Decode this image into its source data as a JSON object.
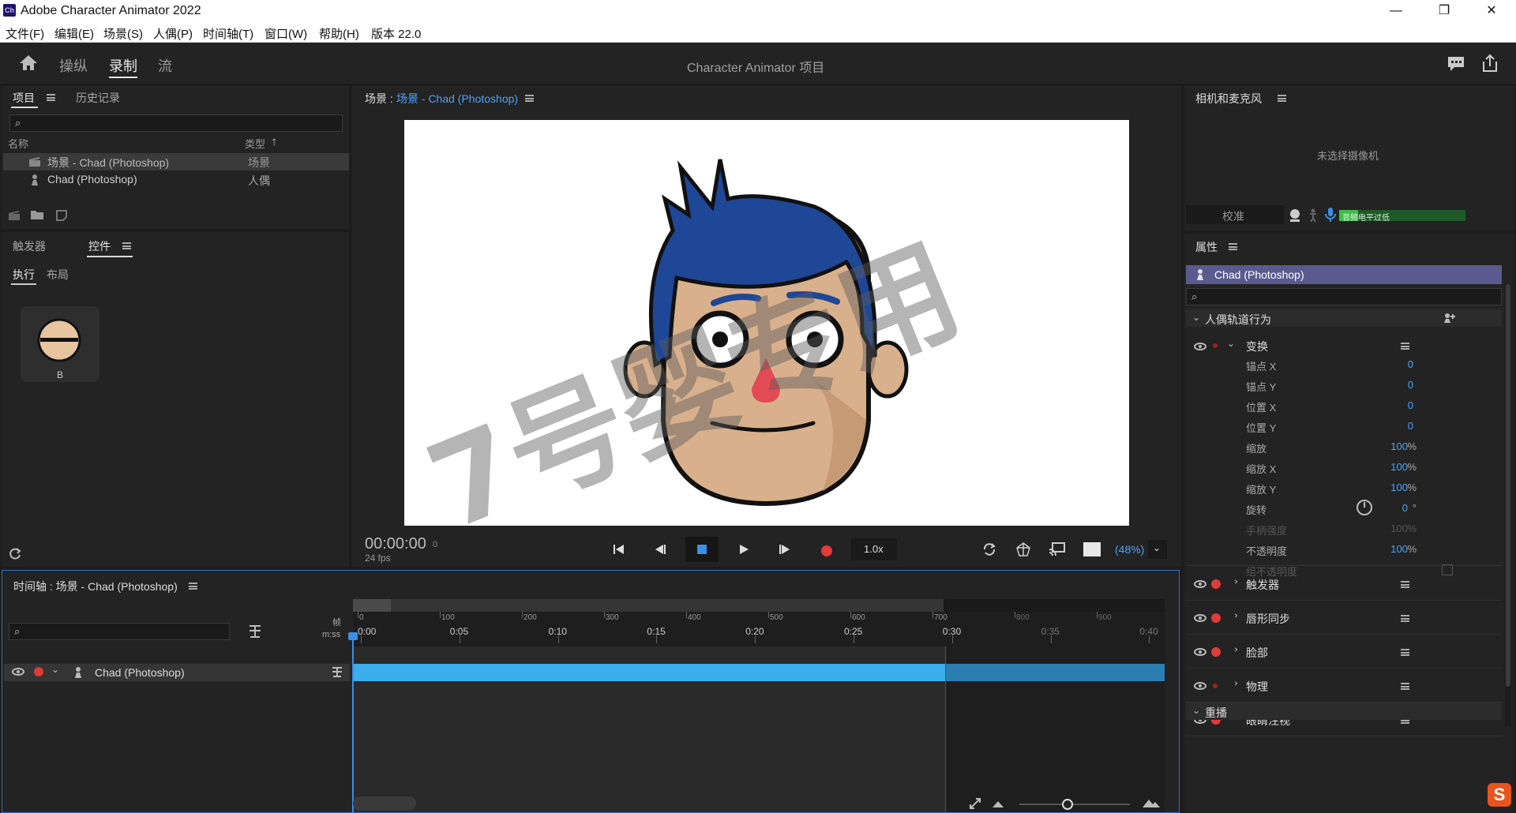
{
  "window": {
    "title": "Adobe Character Animator 2022",
    "app_icon_text": "Ch",
    "minimize": "—",
    "restore": "❐",
    "close": "✕"
  },
  "menu": [
    "文件(F)",
    "编辑(E)",
    "场景(S)",
    "人偶(P)",
    "时间轴(T)",
    "窗口(W)",
    "帮助(H)",
    "版本 22.0"
  ],
  "workspace": {
    "tabs": [
      "操纵",
      "录制",
      "流"
    ],
    "active_tab": "录制",
    "project_title": "Character Animator 项目"
  },
  "project_panel": {
    "tabs": [
      "项目",
      "历史记录"
    ],
    "col_name": "名称",
    "col_type": "类型",
    "sort_arrow": "🡑",
    "rows": [
      {
        "name": "场景 - Chad (Photoshop)",
        "type": "场景"
      },
      {
        "name": "Chad (Photoshop)",
        "type": "人偶"
      }
    ]
  },
  "triggers_panel": {
    "tabs": [
      "触发器",
      "控件"
    ],
    "subtabs": [
      "执行",
      "布局"
    ],
    "control_label": "B"
  },
  "scene_panel": {
    "title_prefix": "场景 : ",
    "title_link": "场景 - Chad (Photoshop)",
    "timecode": "00:00:00",
    "frame": "0",
    "fps": "24 fps",
    "speed": "1.0x",
    "zoom": "(48%)",
    "watermark": "7号婴专用"
  },
  "camera_panel": {
    "title": "相机和麦克风",
    "no_camera": "未选择摄像机",
    "calibrate": "校准",
    "audio_meter": "音频电平过低"
  },
  "properties_panel": {
    "title": "属性",
    "puppet_name": "Chad (Photoshop)",
    "section": "人偶轨道行为",
    "transform": "变换",
    "transform_params": [
      {
        "label": "锚点 X",
        "value": "0",
        "unit": "",
        "dim": false
      },
      {
        "label": "锚点 Y",
        "value": "0",
        "unit": "",
        "dim": false
      },
      {
        "label": "位置 X",
        "value": "0",
        "unit": "",
        "dim": false
      },
      {
        "label": "位置 Y",
        "value": "0",
        "unit": "",
        "dim": false
      },
      {
        "label": "缩放",
        "value": "100",
        "unit": "%",
        "dim": false
      },
      {
        "label": "缩放 X",
        "value": "100",
        "unit": "%",
        "dim": false
      },
      {
        "label": "缩放 Y",
        "value": "100",
        "unit": "%",
        "dim": false
      },
      {
        "label": "旋转",
        "value": "0",
        "unit": "°",
        "dim": false
      },
      {
        "label": "手柄强度",
        "value": "100",
        "unit": "%",
        "dim": true
      },
      {
        "label": "不透明度",
        "value": "100",
        "unit": "%",
        "dim": false
      },
      {
        "label": "组不透明度",
        "value": "",
        "unit": "",
        "dim": true
      }
    ],
    "behaviors": [
      "触发器",
      "唇形同步",
      "脸部",
      "物理",
      "眼睛注视"
    ],
    "replay": "重播"
  },
  "timeline_panel": {
    "title": "时间轴 : 场景 - Chad (Photoshop)",
    "frame_label": "帧",
    "mss_label": "m:ss",
    "frame_ticks": [
      "0",
      "100",
      "200",
      "300",
      "400",
      "500",
      "600",
      "700",
      "800",
      "900"
    ],
    "time_ticks": [
      "0:00",
      "0:05",
      "0:10",
      "0:15",
      "0:20",
      "0:25",
      "0:30",
      "0:35",
      "0:40"
    ],
    "track_name": "Chad (Photoshop)"
  },
  "colors": {
    "accent_blue": "#4aa3ff",
    "track_blue": "#3aaee8",
    "record_red": "#e03a3a",
    "puppet_header": "#5b5a8e",
    "panel_bg": "#232323"
  }
}
